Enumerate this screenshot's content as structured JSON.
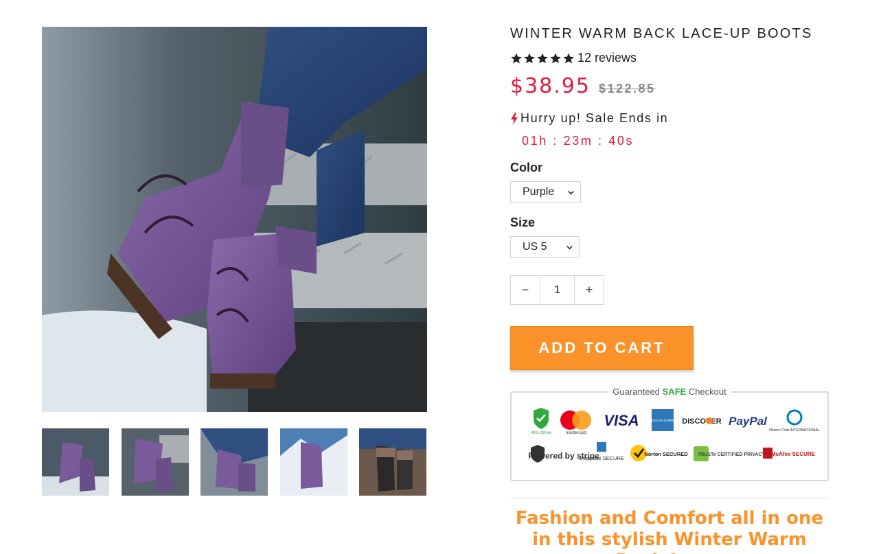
{
  "product": {
    "title": "WINTER WARM BACK LACE-UP BOOTS",
    "rating_stars": 5,
    "reviews": "12 reviews",
    "price": "$38.95",
    "compare_price": "$122.85",
    "sale_label": "Hurry up! Sale Ends in",
    "countdown": "01h : 23m : 40s"
  },
  "options": {
    "color_label": "Color",
    "color_value": "Purple",
    "size_label": "Size",
    "size_value": "US 5"
  },
  "quantity": {
    "minus": "−",
    "value": "1",
    "plus": "+"
  },
  "cart": {
    "add_label": "ADD TO CART"
  },
  "checkout": {
    "title_prefix": "Guaranteed ",
    "title_safe": "SAFE",
    "title_suffix": " Checkout",
    "badges_row1": [
      "AES-256 bit",
      "mastercard",
      "VISA",
      "AMERICAN EXPRESS",
      "DISCOVER",
      "PayPal",
      "Diners Club INTERNATIONAL"
    ],
    "badges_row2": [
      "Powered by stripe",
      "shopbase SECURE",
      "Norton SECURED",
      "TRUSTe CERTIFIED PRIVACY",
      "McAfee SECURE"
    ]
  },
  "description": "Fashion and Comfort all in one in this stylish Winter Warm Back Lace-",
  "colors": {
    "accent_orange": "#fb922a",
    "sale_red": "#e21b3c",
    "boot_purple": "#7a5a9a"
  }
}
